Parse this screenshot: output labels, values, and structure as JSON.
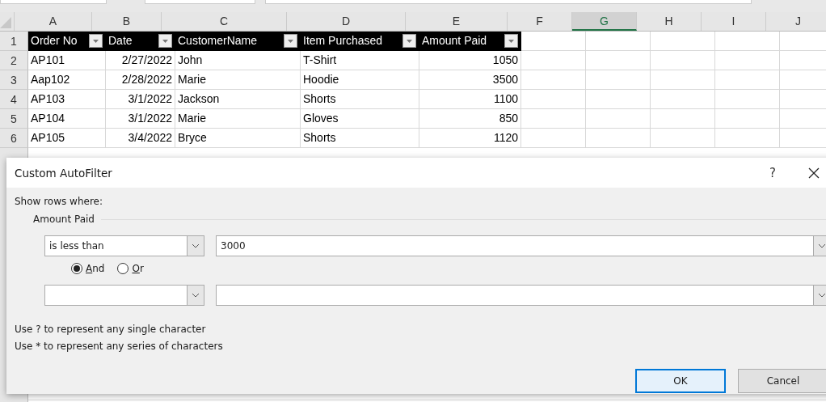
{
  "columns": [
    {
      "label": "A",
      "selected": false
    },
    {
      "label": "B",
      "selected": false
    },
    {
      "label": "C",
      "selected": false
    },
    {
      "label": "D",
      "selected": false
    },
    {
      "label": "E",
      "selected": false
    },
    {
      "label": "F",
      "selected": false
    },
    {
      "label": "G",
      "selected": true
    },
    {
      "label": "H",
      "selected": false
    },
    {
      "label": "I",
      "selected": false
    },
    {
      "label": "J",
      "selected": false
    }
  ],
  "header_row": {
    "number": "1",
    "cells": [
      "Order No",
      "Date",
      "CustomerName",
      "Item Purchased",
      "Amount Paid"
    ]
  },
  "rows": [
    {
      "number": "2",
      "cells": [
        "AP101",
        "2/27/2022",
        "John",
        "T-Shirt",
        "1050"
      ]
    },
    {
      "number": "3",
      "cells": [
        "Aap102",
        "2/28/2022",
        "Marie",
        "Hoodie",
        "3500"
      ]
    },
    {
      "number": "4",
      "cells": [
        "AP103",
        "3/1/2022",
        "Jackson",
        "Shorts",
        "1100"
      ]
    },
    {
      "number": "5",
      "cells": [
        "AP104",
        "3/1/2022",
        "Marie",
        "Gloves",
        "850"
      ]
    },
    {
      "number": "6",
      "cells": [
        "AP105",
        "3/4/2022",
        "Bryce",
        "Shorts",
        "1120"
      ]
    }
  ],
  "dialog": {
    "title": "Custom AutoFilter",
    "help": "?",
    "intro": "Show rows where:",
    "field": "Amount Paid",
    "condition_1": {
      "operator": "is less than",
      "value": "3000"
    },
    "joins": [
      {
        "label": "And",
        "selected": true
      },
      {
        "label": "Or",
        "selected": false
      }
    ],
    "hints": [
      "Use ? to represent any single character",
      "Use * to represent any series of characters"
    ],
    "buttons": [
      {
        "label": "OK",
        "focused": true
      },
      {
        "label": "Cancel",
        "focused": false
      }
    ]
  }
}
